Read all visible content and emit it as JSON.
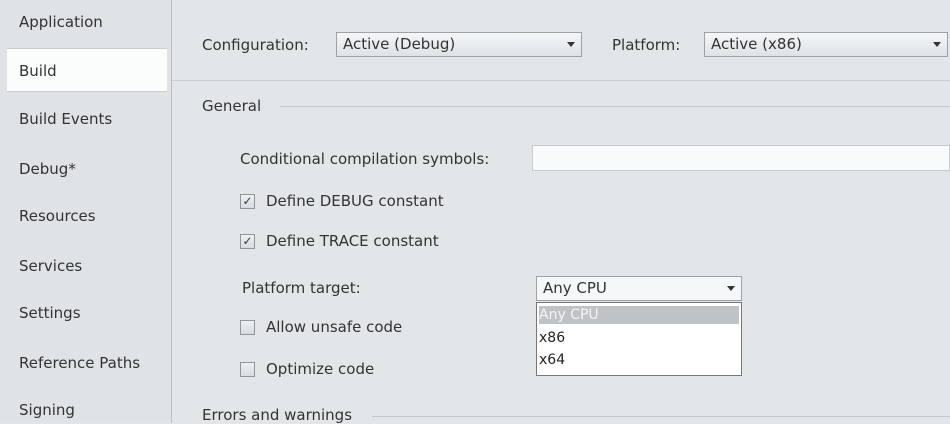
{
  "sidebar": {
    "items": [
      {
        "label": "Application"
      },
      {
        "label": "Build"
      },
      {
        "label": "Build Events"
      },
      {
        "label": "Debug*"
      },
      {
        "label": "Resources"
      },
      {
        "label": "Services"
      },
      {
        "label": "Settings"
      },
      {
        "label": "Reference Paths"
      },
      {
        "label": "Signing"
      }
    ],
    "active": "Build"
  },
  "header": {
    "configuration_label": "Configuration:",
    "configuration_value": "Active (Debug)",
    "platform_label": "Platform:",
    "platform_value": "Active (x86)"
  },
  "general": {
    "section_title": "General",
    "conditional_symbols_label": "Conditional compilation symbols:",
    "conditional_symbols_value": "",
    "define_debug": {
      "label": "Define DEBUG constant",
      "checked": true
    },
    "define_trace": {
      "label": "Define TRACE constant",
      "checked": true
    },
    "platform_target_label": "Platform target:",
    "platform_target_value": "Any CPU",
    "platform_target_options": [
      "Any CPU",
      "x86",
      "x64"
    ],
    "allow_unsafe": {
      "label": "Allow unsafe code",
      "checked": false
    },
    "optimize": {
      "label": "Optimize code",
      "checked": false
    }
  },
  "errors_section_title": "Errors and warnings",
  "icons": {
    "check": "✓",
    "dropdown_arrow": "chevron-down-icon"
  }
}
